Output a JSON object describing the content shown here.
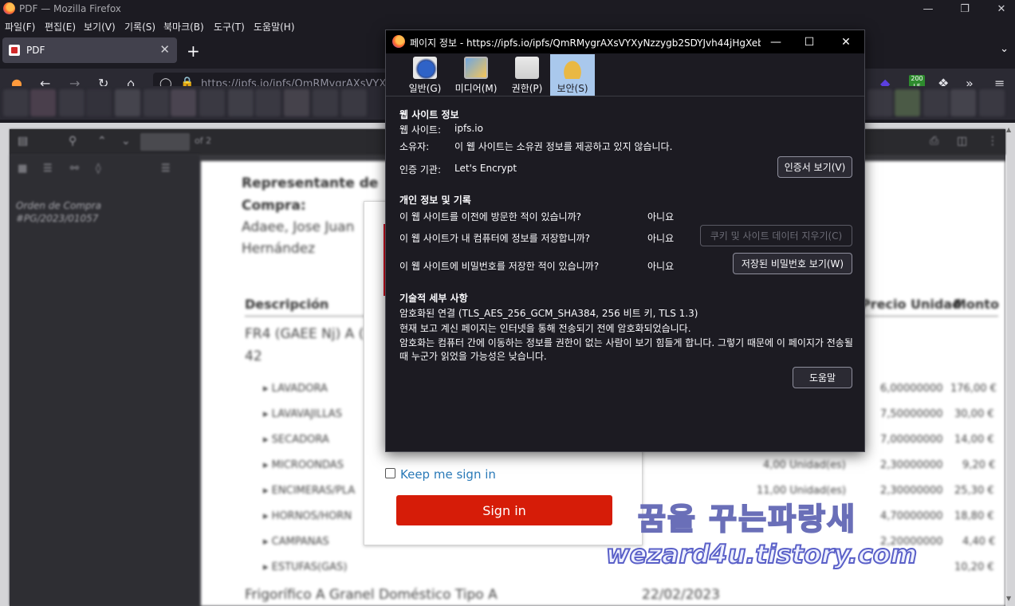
{
  "window": {
    "title": "PDF — Mozilla Firefox"
  },
  "menu": [
    "파일(F)",
    "편집(E)",
    "보기(V)",
    "기록(S)",
    "북마크(B)",
    "도구(T)",
    "도움말(H)"
  ],
  "tab": {
    "label": "PDF"
  },
  "urlbar": {
    "url": "https://ipfs.io/ipfs/QmRMygrAXsVYXy"
  },
  "toolbar": {
    "badge": "200\nLF"
  },
  "pdf": {
    "page_of": "of 2",
    "sidebar_outline": "Orden de Compra #PG/2023/01057",
    "heading1": "Representante de",
    "heading2": "Compra:",
    "name1": "Adaee, Jose Juan",
    "name2": "Hernández",
    "col_desc": "Descripción",
    "col_price": "Precio Unidad",
    "col_amount": "Monto",
    "group1": "FR4 (GAEE Nj) A (",
    "group1b": "42",
    "items": [
      {
        "name": "LAVADORA",
        "qty": "",
        "price": "6,00000000",
        "amount": "176,00 €"
      },
      {
        "name": "LAVAVAJILLAS",
        "qty": "",
        "price": "7,50000000",
        "amount": "30,00 €"
      },
      {
        "name": "SECADORA",
        "qty": "",
        "price": "7,00000000",
        "amount": "14,00 €"
      },
      {
        "name": "MICROONDAS",
        "qty": "4,00 Unidad(es)",
        "price": "2,30000000",
        "amount": "9,20 €"
      },
      {
        "name": "ENCIMERAS/PLA",
        "qty": "11,00 Unidad(es)",
        "price": "2,30000000",
        "amount": "25,30 €"
      },
      {
        "name": "HORNOS/HORN",
        "qty": "",
        "price": "4,70000000",
        "amount": "18,80 €"
      },
      {
        "name": "CAMPANAS",
        "qty": "",
        "price": "2,20000000",
        "amount": "4,40 €"
      },
      {
        "name": "ESTUFAS(GAS)",
        "qty": "",
        "price": "",
        "amount": "10,20 €"
      }
    ],
    "footer_desc": "Frigorífico A Granel Doméstico Tipo A",
    "footer_date": "22/02/2023"
  },
  "login": {
    "keep_signed_in": "Keep me sign in",
    "signin_button": "Sign in"
  },
  "watermark": {
    "line1": "꿈을 꾸는파랑새",
    "line2": "wezard4u.tistory.com"
  },
  "dialog": {
    "title": "페이지 정보 - https://ipfs.io/ipfs/QmRMygrAXsVYXyNzzygb2SDYJvh44jHgXeb...",
    "tabs": [
      "일반(G)",
      "미디어(M)",
      "권한(P)",
      "보안(S)"
    ],
    "website_section": "웹 사이트 정보",
    "website_label": "웹 사이트:",
    "website_value": "ipfs.io",
    "owner_label": "소유자:",
    "owner_value": "이 웹 사이트는 소유권 정보를 제공하고 있지 않습니다.",
    "issuer_label": "인증 기관:",
    "issuer_value": "Let's Encrypt",
    "view_cert_button": "인증서 보기(V)",
    "privacy_section": "개인 정보 및 기록",
    "visited_q": "이 웹 사이트를 이전에 방문한 적이 있습니까?",
    "visited_a": "아니요",
    "storing_q": "이 웹 사이트가 내 컴퓨터에 정보를 저장합니까?",
    "storing_a": "아니요",
    "clear_cookies_button": "쿠키 및 사이트 데이터 지우기(C)",
    "passwords_q": "이 웹 사이트에 비밀번호를 저장한 적이 있습니까?",
    "passwords_a": "아니요",
    "view_passwords_button": "저장된 비밀번호 보기(W)",
    "tech_section": "기술적 세부 사항",
    "tech_line1": "암호화된 연결 (TLS_AES_256_GCM_SHA384, 256 비트 키, TLS 1.3)",
    "tech_line2": "현재 보고 계신 페이지는 인터넷을 통해 전송되기 전에 암호화되었습니다.",
    "tech_para": "암호화는 컴퓨터 간에 이동하는 정보를 권한이 없는 사람이 보기 힘들게 합니다. 그렇기 때문에 이 페이지가 전송될 때 누군가 읽었을 가능성은 낮습니다.",
    "help_button": "도움말"
  }
}
